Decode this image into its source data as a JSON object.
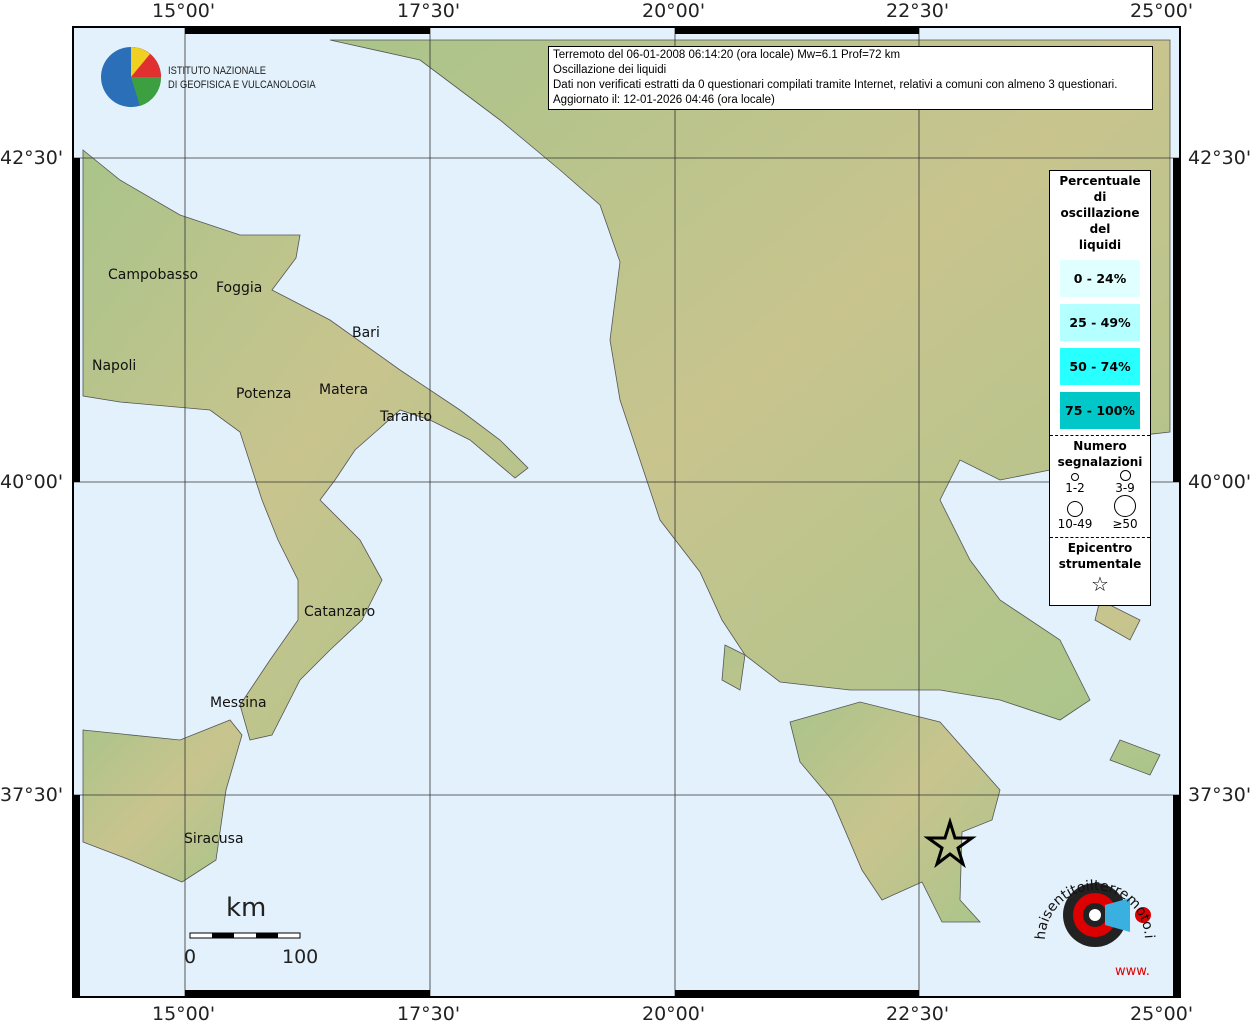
{
  "info_box": {
    "line1": "Terremoto del 06-01-2008 06:14:20 (ora locale) Mw=6.1 Prof=72 km",
    "line2": "Oscillazione dei liquidi",
    "line3": "Dati non verificati estratti da 0 questionari compilati tramite Internet, relativi a comuni con almeno 3 questionari.",
    "line4": "Aggiornato il: 12-01-2026 04:46 (ora locale)"
  },
  "institute": {
    "line1": "ISTITUTO NAZIONALE",
    "line2": "DI GEOFISICA E VULCANOLOGIA"
  },
  "axes": {
    "lon_labels": [
      "15°00'",
      "17°30'",
      "20°00'",
      "22°30'",
      "25°00'"
    ],
    "lat_labels": [
      "42°30'",
      "40°00'",
      "37°30'"
    ]
  },
  "cities": [
    "Campobasso",
    "Foggia",
    "Bari",
    "Napoli",
    "Potenza",
    "Matera",
    "Taranto",
    "Catanzaro",
    "Messina",
    "Siracusa"
  ],
  "legend": {
    "title": [
      "Percentuale",
      "di",
      "oscillazione",
      "del",
      "liquidi"
    ],
    "classes": [
      {
        "label": "0 - 24%",
        "color": "#e0ffff"
      },
      {
        "label": "25 - 49%",
        "color": "#b4ffff"
      },
      {
        "label": "50 - 74%",
        "color": "#28ffff"
      },
      {
        "label": "75 - 100%",
        "color": "#00c8c8"
      }
    ],
    "count_title": [
      "Numero",
      "segnalazioni"
    ],
    "counts": [
      "1-2",
      "3-9",
      "10-49",
      "≥50"
    ],
    "epicenter_title": [
      "Epicentro",
      "strumentale"
    ]
  },
  "scale": {
    "unit": "km",
    "min": "0",
    "max": "100"
  },
  "haisentito": {
    "text": "haisentitoilterremoto.it",
    "url": "www."
  },
  "colors": {
    "sea": "#e2f1fb",
    "land": "#b9c98a"
  }
}
